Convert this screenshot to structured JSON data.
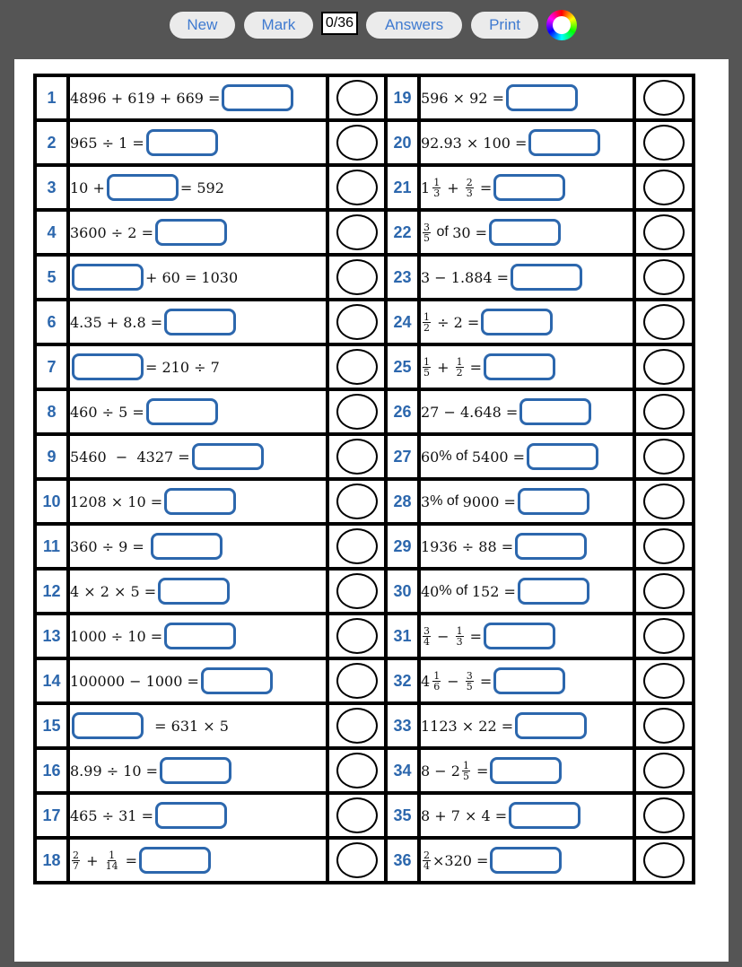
{
  "toolbar": {
    "new_label": "New",
    "mark_label": "Mark",
    "score": "0/36",
    "answers_label": "Answers",
    "print_label": "Print",
    "color_icon": "color-wheel-icon"
  },
  "questions": [
    {
      "num": "1",
      "parts": [
        {
          "t": "4896 + 619 + 669 ="
        },
        {
          "box": true
        }
      ]
    },
    {
      "num": "2",
      "parts": [
        {
          "t": "965 ÷ 1 ="
        },
        {
          "box": true
        }
      ]
    },
    {
      "num": "3",
      "parts": [
        {
          "t": "10 +"
        },
        {
          "box": true
        },
        {
          "t": "= 592"
        }
      ]
    },
    {
      "num": "4",
      "parts": [
        {
          "t": "3600 ÷ 2 ="
        },
        {
          "box": true
        }
      ]
    },
    {
      "num": "5",
      "parts": [
        {
          "box": true
        },
        {
          "t": "+ 60 = 1030"
        }
      ]
    },
    {
      "num": "6",
      "parts": [
        {
          "t": "4.35 + 8.8 ="
        },
        {
          "box": true
        }
      ]
    },
    {
      "num": "7",
      "parts": [
        {
          "box": true
        },
        {
          "t": "= 210 ÷ 7"
        }
      ]
    },
    {
      "num": "8",
      "parts": [
        {
          "t": "460 ÷ 5 ="
        },
        {
          "box": true
        }
      ]
    },
    {
      "num": "9",
      "parts": [
        {
          "t": "5460  −  4327 ="
        },
        {
          "box": true
        }
      ]
    },
    {
      "num": "10",
      "parts": [
        {
          "t": "1208 × 10 ="
        },
        {
          "box": true
        }
      ]
    },
    {
      "num": "11",
      "parts": [
        {
          "t": "360 ÷ 9 = "
        },
        {
          "box": true
        }
      ]
    },
    {
      "num": "12",
      "parts": [
        {
          "t": "4 × 2 × 5 ="
        },
        {
          "box": true
        }
      ]
    },
    {
      "num": "13",
      "parts": [
        {
          "t": "1000 ÷ 10 ="
        },
        {
          "box": true
        }
      ]
    },
    {
      "num": "14",
      "parts": [
        {
          "t": "100000 − 1000 ="
        },
        {
          "box": true
        }
      ]
    },
    {
      "num": "15",
      "parts": [
        {
          "box": true
        },
        {
          "t": "  = 631 × 5"
        }
      ]
    },
    {
      "num": "16",
      "parts": [
        {
          "t": "8.99 ÷ 10 ="
        },
        {
          "box": true
        }
      ]
    },
    {
      "num": "17",
      "parts": [
        {
          "t": "465 ÷ 31 ="
        },
        {
          "box": true
        }
      ]
    },
    {
      "num": "18",
      "parts": [
        {
          "frac": [
            "2",
            "7"
          ]
        },
        {
          "t": " + "
        },
        {
          "frac": [
            "1",
            "14"
          ]
        },
        {
          "t": " ="
        },
        {
          "box": true
        }
      ]
    },
    {
      "num": "19",
      "parts": [
        {
          "t": "596 × 92 ="
        },
        {
          "box": true
        }
      ]
    },
    {
      "num": "20",
      "parts": [
        {
          "t": "92.93 × 100 ="
        },
        {
          "box": true
        }
      ]
    },
    {
      "num": "21",
      "parts": [
        {
          "whole": "1"
        },
        {
          "frac": [
            "1",
            "3"
          ]
        },
        {
          "t": " + "
        },
        {
          "frac": [
            "2",
            "3"
          ]
        },
        {
          "t": " ="
        },
        {
          "box": true
        }
      ]
    },
    {
      "num": "22",
      "parts": [
        {
          "frac": [
            "3",
            "5"
          ]
        },
        {
          "w": " of "
        },
        {
          "t": "30 ="
        },
        {
          "box": true
        }
      ]
    },
    {
      "num": "23",
      "parts": [
        {
          "t": "3 − 1.884 ="
        },
        {
          "box": true
        }
      ]
    },
    {
      "num": "24",
      "parts": [
        {
          "frac": [
            "1",
            "2"
          ]
        },
        {
          "t": " ÷ 2 ="
        },
        {
          "box": true
        }
      ]
    },
    {
      "num": "25",
      "parts": [
        {
          "frac": [
            "1",
            "5"
          ]
        },
        {
          "t": " + "
        },
        {
          "frac": [
            "1",
            "2"
          ]
        },
        {
          "t": " ="
        },
        {
          "box": true
        }
      ]
    },
    {
      "num": "26",
      "parts": [
        {
          "t": "27 − 4.648 ="
        },
        {
          "box": true
        }
      ]
    },
    {
      "num": "27",
      "parts": [
        {
          "t": "60"
        },
        {
          "w": "% of "
        },
        {
          "t": "5400 ="
        },
        {
          "box": true
        }
      ]
    },
    {
      "num": "28",
      "parts": [
        {
          "t": "3"
        },
        {
          "w": "% of "
        },
        {
          "t": "9000 ="
        },
        {
          "box": true
        }
      ]
    },
    {
      "num": "29",
      "parts": [
        {
          "t": "1936 ÷ 88 ="
        },
        {
          "box": true
        }
      ]
    },
    {
      "num": "30",
      "parts": [
        {
          "t": "40"
        },
        {
          "w": "% of "
        },
        {
          "t": "152 ="
        },
        {
          "box": true
        }
      ]
    },
    {
      "num": "31",
      "parts": [
        {
          "frac": [
            "3",
            "4"
          ]
        },
        {
          "t": " − "
        },
        {
          "frac": [
            "1",
            "3"
          ]
        },
        {
          "t": " ="
        },
        {
          "box": true
        }
      ]
    },
    {
      "num": "32",
      "parts": [
        {
          "whole": "4"
        },
        {
          "frac": [
            "1",
            "6"
          ]
        },
        {
          "t": " − "
        },
        {
          "frac": [
            "3",
            "5"
          ]
        },
        {
          "t": " ="
        },
        {
          "box": true
        }
      ]
    },
    {
      "num": "33",
      "parts": [
        {
          "t": "1123 × 22 ="
        },
        {
          "box": true
        }
      ]
    },
    {
      "num": "34",
      "parts": [
        {
          "t": "8 − 2"
        },
        {
          "frac": [
            "1",
            "5"
          ]
        },
        {
          "t": " ="
        },
        {
          "box": true
        }
      ]
    },
    {
      "num": "35",
      "parts": [
        {
          "t": "8 + 7 × 4 ="
        },
        {
          "box": true
        }
      ]
    },
    {
      "num": "36",
      "parts": [
        {
          "frac": [
            "2",
            "4"
          ]
        },
        {
          "t": "×320 ="
        },
        {
          "box": true
        }
      ]
    }
  ],
  "answers": {},
  "colors": {
    "background": "#555555",
    "number_blue": "#2c67ad",
    "answer_box_border": "#2c67ad",
    "button_text": "#3f7ad0",
    "button_bg": "#ebebeb"
  }
}
